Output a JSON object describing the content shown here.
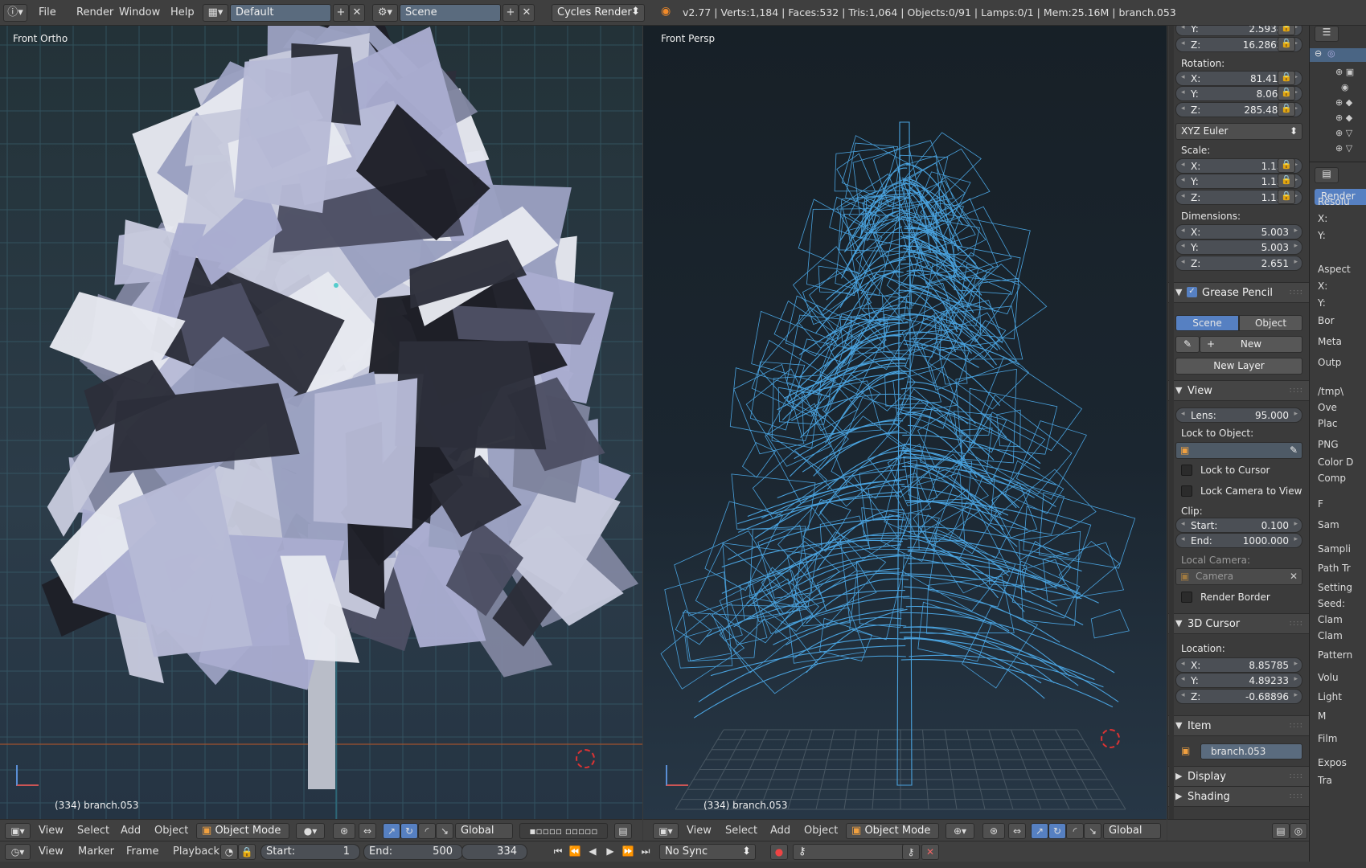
{
  "topbar": {
    "menus": [
      "File",
      "Render",
      "Window",
      "Help"
    ],
    "screen_layout": "Default",
    "scene": "Scene",
    "engine": "Cycles Render",
    "stats": "v2.77 | Verts:1,184 | Faces:532 | Tris:1,064 | Objects:0/91 | Lamps:0/1 | Mem:25.16M | branch.053"
  },
  "left_view": {
    "label": "Front Ortho",
    "object": "(334) branch.053"
  },
  "right_view": {
    "label": "Front Persp",
    "object": "(334) branch.053"
  },
  "npanel": {
    "location_y": "2.59382",
    "location_z": "16.28621",
    "rotation_label": "Rotation:",
    "rotation": {
      "x": "81.413°",
      "y": "8.061°",
      "z": "285.485°"
    },
    "rotation_mode": "XYZ Euler",
    "scale_label": "Scale:",
    "scale": {
      "x": "1.132",
      "y": "1.132",
      "z": "1.132"
    },
    "dimensions_label": "Dimensions:",
    "dimensions": {
      "x": "5.003",
      "y": "5.003",
      "z": "2.651"
    },
    "grease_pencil": {
      "title": "Grease Pencil",
      "tab_scene": "Scene",
      "tab_object": "Object",
      "new": "New",
      "new_layer": "New Layer"
    },
    "view": {
      "title": "View",
      "lens_label": "Lens:",
      "lens": "95.000",
      "lock_object_label": "Lock to Object:",
      "lock_cursor": "Lock to Cursor",
      "lock_camera": "Lock Camera to View",
      "clip_label": "Clip:",
      "clip_start_label": "Start:",
      "clip_start": "0.100",
      "clip_end_label": "End:",
      "clip_end": "1000.000",
      "local_camera_label": "Local Camera:",
      "local_camera": "Camera",
      "render_border": "Render Border"
    },
    "cursor": {
      "title": "3D Cursor",
      "location_label": "Location:",
      "x": "8.85785",
      "y": "4.89233",
      "z": "-0.68896"
    },
    "item": {
      "title": "Item",
      "name": "branch.053"
    },
    "display": "Display",
    "shading": "Shading"
  },
  "view_header": {
    "menus": [
      "View",
      "Select",
      "Add",
      "Object"
    ],
    "mode": "Object Mode",
    "orientation": "Global"
  },
  "timeline": {
    "menus": [
      "View",
      "Marker",
      "Frame",
      "Playback"
    ],
    "start_label": "Start:",
    "start": "1",
    "end_label": "End:",
    "end": "500",
    "current": "334",
    "sync": "No Sync"
  },
  "props_edge": {
    "render_tab": "Render",
    "labels": [
      "Resolu",
      "X:",
      "Y:",
      "Aspect",
      "X:",
      "Y:",
      "Bor",
      "Meta",
      "Outp",
      "/tmp\\",
      "Ove",
      "Plac",
      "PNG",
      "Color D",
      "Comp",
      "F",
      "Sam",
      "Sampli",
      "Path Tr",
      "Setting",
      "Seed:",
      "Clam",
      "Clam",
      "Pattern",
      "Volu",
      "Light",
      "M",
      "Film",
      "Expos",
      "Tra"
    ]
  },
  "colors": {
    "wire": "#4aa3df",
    "accent": "#5680c2",
    "grid": "#3d6a78"
  }
}
